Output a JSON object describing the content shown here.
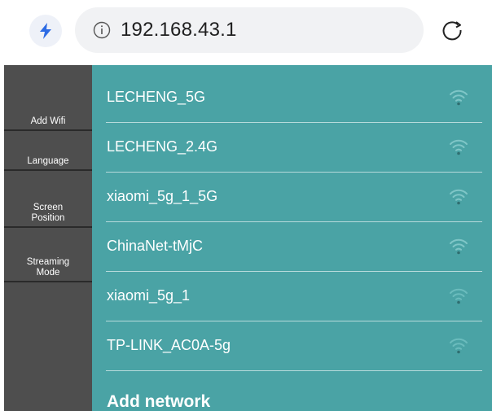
{
  "browser": {
    "url": "192.168.43.1",
    "bolt_icon": "bolt-icon",
    "info_icon": "info-icon",
    "refresh_icon": "refresh-icon",
    "accent": "#2d6be4"
  },
  "sidebar": {
    "items": [
      {
        "label": "Add Wifi"
      },
      {
        "label": "Language"
      },
      {
        "label": "Screen\nPosition"
      },
      {
        "label": "Streaming\nMode"
      }
    ],
    "bg": "#4e4e4e"
  },
  "networks": {
    "bg": "#4aa3a5",
    "items": [
      {
        "name": "LECHENG_5G",
        "signal": "strong"
      },
      {
        "name": "LECHENG_2.4G",
        "signal": "strong"
      },
      {
        "name": "xiaomi_5g_1_5G",
        "signal": "strong"
      },
      {
        "name": "ChinaNet-tMjC",
        "signal": "strong"
      },
      {
        "name": "xiaomi_5g_1",
        "signal": "weak"
      },
      {
        "name": "TP-LINK_AC0A-5g",
        "signal": "weak"
      }
    ],
    "add_label": "Add network"
  }
}
